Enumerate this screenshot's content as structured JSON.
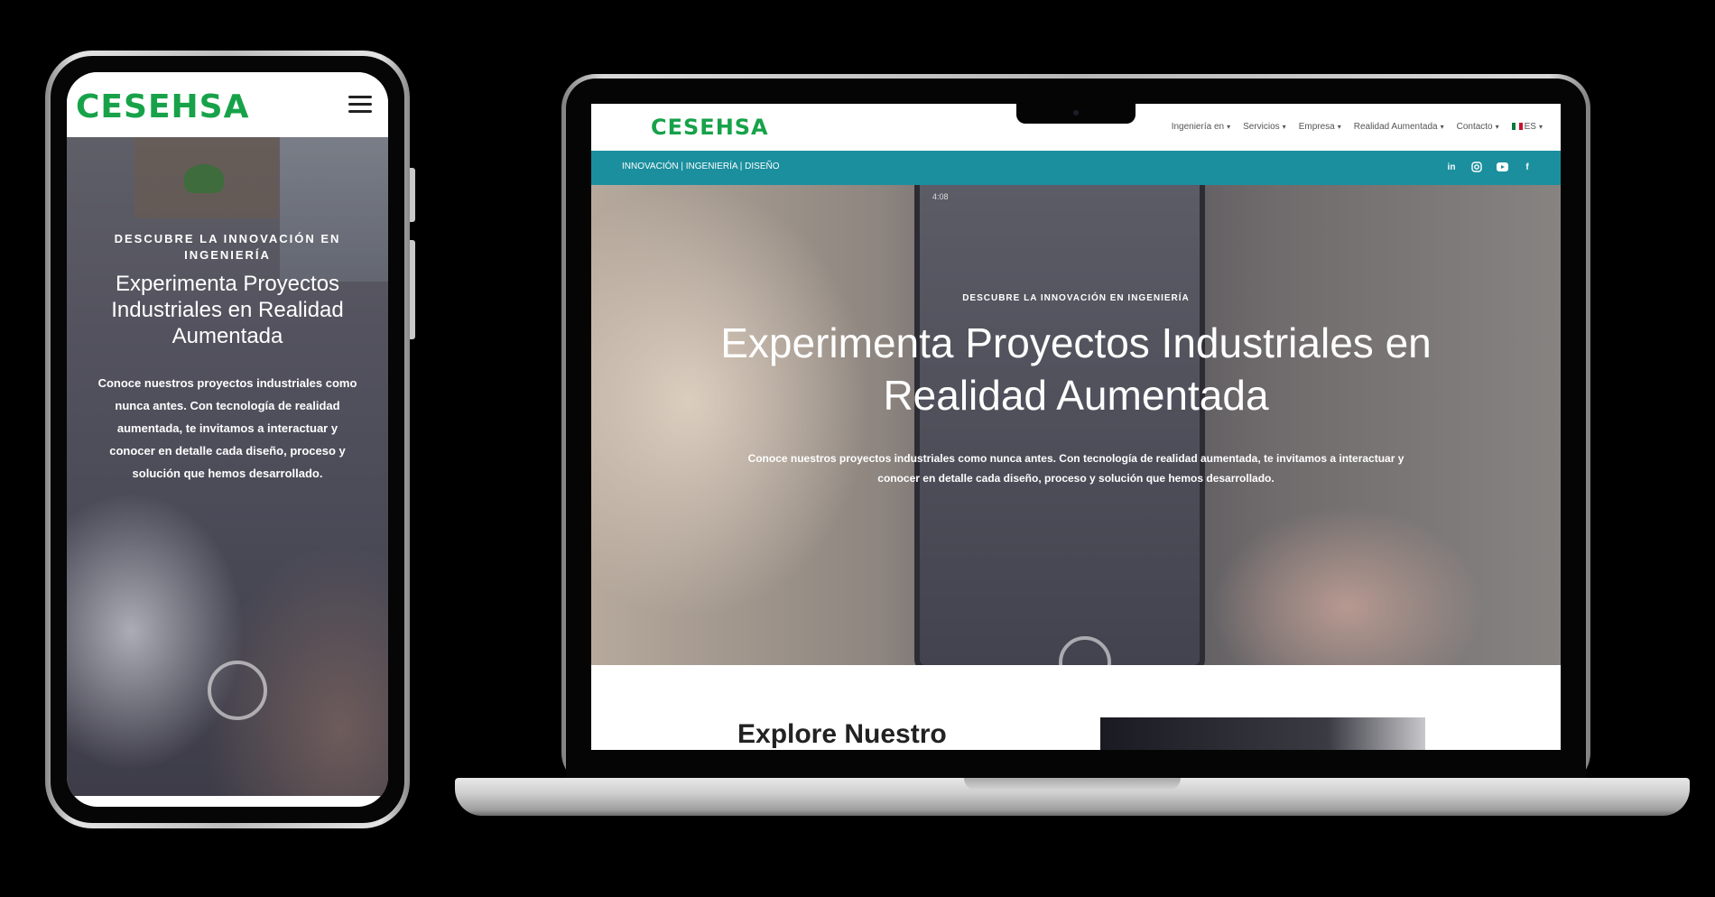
{
  "brand": {
    "logo": "CESEHSA",
    "accent": "#17a24a",
    "topbar_color": "#1b8f9e"
  },
  "mobile": {
    "menu_icon": "hamburger-icon",
    "hero": {
      "eyebrow": "DESCUBRE LA INNOVACIÓN EN INGENIERÍA",
      "title": "Experimenta Proyectos Industriales en Realidad Aumentada",
      "text": "Conoce nuestros proyectos industriales como nunca antes. Con tecnología de realidad aumentada, te invitamos a interactuar y conocer en detalle cada diseño, proceso y solución que hemos desarrollado."
    }
  },
  "desktop": {
    "nav": [
      "Ingeniería en",
      "Servicios",
      "Empresa",
      "Realidad Aumentada",
      "Contacto"
    ],
    "language": "ES",
    "tagline": "INNOVACIÓN | INGENIERÍA | DISEÑO",
    "social": [
      "in",
      "ig",
      "yt",
      "f"
    ],
    "hero": {
      "status_time": "4:08",
      "eyebrow": "DESCUBRE LA INNOVACIÓN EN INGENIERÍA",
      "title": "Experimenta Proyectos Industriales en Realidad Aumentada",
      "text": "Conoce nuestros proyectos industriales como nunca antes. Con tecnología de realidad aumentada, te invitamos a interactuar y conocer en detalle cada diseño, proceso y solución que hemos desarrollado."
    },
    "next_section_title": "Explore Nuestro"
  }
}
